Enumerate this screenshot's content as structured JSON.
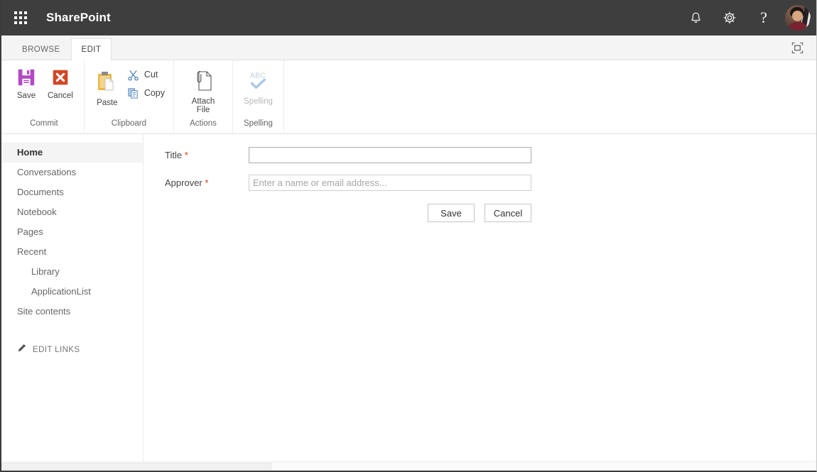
{
  "suite": {
    "app_launcher": "app-launcher-waffle",
    "title": "SharePoint",
    "notifications_icon": "bell-icon",
    "settings_icon": "gear-icon",
    "help_icon": "question-mark-icon",
    "help_glyph": "?",
    "avatar": "user-avatar-photo",
    "bg_color": "#3e3e3e"
  },
  "ribbon": {
    "tabs": [
      {
        "label": "BROWSE",
        "active": false
      },
      {
        "label": "EDIT",
        "active": true
      }
    ],
    "focus_on_content_icon": "focus-on-content-icon",
    "groups": [
      {
        "label": "Commit",
        "buttons": [
          {
            "label": "Save",
            "icon": "save-floppy-disk-icon",
            "disabled": false
          },
          {
            "label": "Cancel",
            "icon": "cancel-red-x-icon",
            "disabled": false
          }
        ]
      },
      {
        "label": "Clipboard",
        "buttons": [
          {
            "label": "Paste",
            "icon": "paste-clipboard-icon",
            "disabled": false
          }
        ],
        "small_buttons": [
          {
            "label": "Cut",
            "icon": "cut-scissors-icon"
          },
          {
            "label": "Copy",
            "icon": "copy-documents-icon"
          }
        ]
      },
      {
        "label": "Actions",
        "buttons": [
          {
            "label": "Attach File",
            "icon": "attach-file-paperclip-icon",
            "disabled": false
          }
        ]
      },
      {
        "label": "Spelling",
        "buttons": [
          {
            "label": "Spelling",
            "icon": "spelling-abc-check-icon",
            "disabled": true
          }
        ]
      }
    ]
  },
  "left_nav": {
    "items": [
      {
        "label": "Home",
        "selected": true,
        "child": false
      },
      {
        "label": "Conversations",
        "selected": false,
        "child": false
      },
      {
        "label": "Documents",
        "selected": false,
        "child": false
      },
      {
        "label": "Notebook",
        "selected": false,
        "child": false
      },
      {
        "label": "Pages",
        "selected": false,
        "child": false
      },
      {
        "label": "Recent",
        "selected": false,
        "child": false
      },
      {
        "label": "Library",
        "selected": false,
        "child": true
      },
      {
        "label": "ApplicationList",
        "selected": false,
        "child": true
      },
      {
        "label": "Site contents",
        "selected": false,
        "child": false
      }
    ],
    "edit_links": {
      "label": "EDIT LINKS",
      "icon": "pencil-icon"
    }
  },
  "form": {
    "fields": [
      {
        "label": "Title",
        "required": true,
        "required_marker": "*",
        "value": "",
        "placeholder": ""
      },
      {
        "label": "Approver",
        "required": true,
        "required_marker": "*",
        "value": "",
        "placeholder": "Enter a name or email address..."
      }
    ],
    "save_label": "Save",
    "cancel_label": "Cancel"
  },
  "colors": {
    "suite_bar": "#3e3e3e",
    "required_star": "#d83b01",
    "save_icon": "#b14bc4",
    "cancel_icon": "#d24726",
    "paste_icon": "#e8b84b",
    "cut_copy_icon": "#4a7ebb",
    "selected_nav_bg": "#f4f4f4"
  }
}
